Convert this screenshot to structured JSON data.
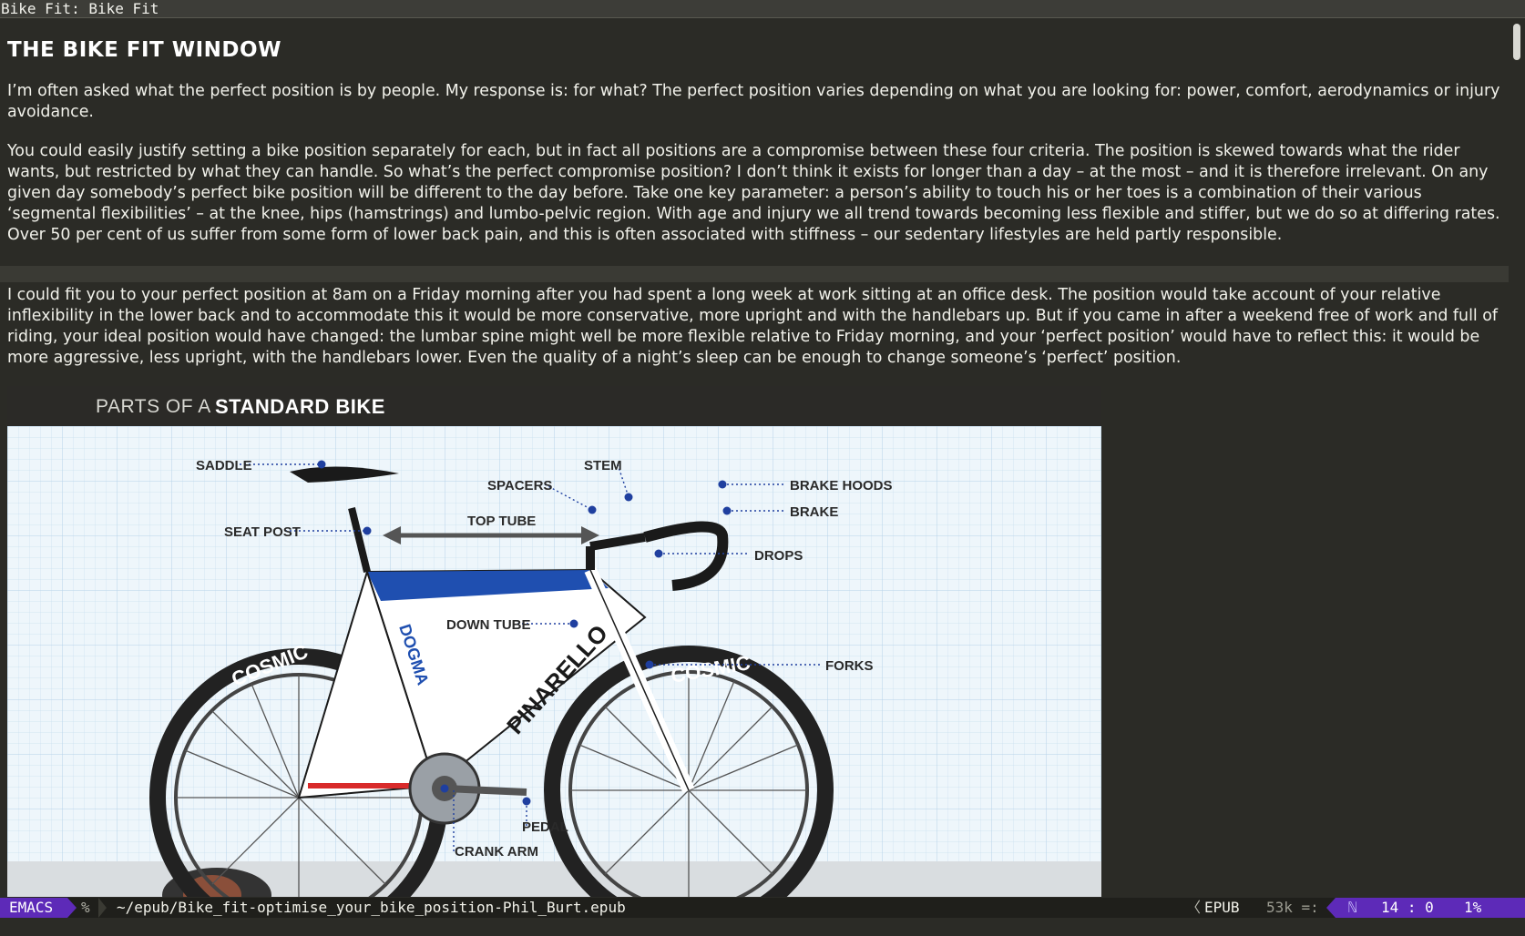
{
  "window": {
    "title": "Bike Fit: Bike Fit"
  },
  "article": {
    "heading": "THE BIKE FIT WINDOW",
    "paragraphs": [
      "I’m often asked what the perfect position is by people. My response is: for what? The perfect position varies depending on what you are looking for: power, comfort, aerodynamics or injury avoidance.",
      "You could easily justify setting a bike position separately for each, but in fact all positions are a compromise between these four criteria. The position is skewed towards what the rider wants, but restricted by what they can handle. So what’s the perfect compromise position? I don’t think it exists for longer than a day – at the most – and it is therefore irrelevant. On any given day somebody’s perfect bike position will be different to the day before. Take one key parameter: a person’s ability to touch his or her toes is a combination of their various ‘segmental flexibilities’ – at the knee, hips (hamstrings) and lumbo-pelvic region. With age and injury we all trend towards becoming less flexible and stiffer, but we do so at differing rates. Over 50 per cent of us suffer from some form of lower back pain, and this is often associated with stiffness – our sedentary lifestyles are held partly responsible.",
      "I could fit you to your perfect position at 8am on a Friday morning after you had spent a long week at work sitting at an office desk. The position would take account of your relative inflexibility in the lower back and to accommodate this it would be more conservative, more upright and with the handlebars up. But if you came in after a weekend free of work and full of riding, your ideal position would have changed: the lumbar spine might well be more flexible relative to Friday morning, and your ‘perfect position’ would have to reflect this: it would be more aggressive, less upright, with the handlebars lower. Even the quality of a night’s sleep can be enough to change someone’s ‘perfect’ position."
    ]
  },
  "figure": {
    "title_prefix": "PARTS OF A",
    "title_main": "STANDARD BIKE",
    "bike_brand": "PINARELLO",
    "bike_model": "DOGMA",
    "wheel_brand": "COSMIC",
    "labels": {
      "saddle": "SADDLE",
      "seat_post": "SEAT POST",
      "spacers": "SPACERS",
      "stem": "STEM",
      "top_tube": "TOP TUBE",
      "brake_hoods": "BRAKE HOODS",
      "brake": "BRAKE",
      "drops": "DROPS",
      "down_tube": "DOWN TUBE",
      "forks": "FORKS",
      "pedal": "PEDAL",
      "crank_arm": "CRANK ARM"
    }
  },
  "modeline": {
    "mode": "EMACS",
    "modified": "%",
    "file": "~/epub/Bike_fit-optimise_your_bike_position-Phil_Burt.epub",
    "major_mode": "EPUB",
    "size": "53k =:",
    "flag": "ℕ",
    "line_col": "14 :  0",
    "percent": "1%"
  },
  "colors": {
    "background": "#2b2b26",
    "text": "#f1f1ea",
    "accent": "#5d2ab8",
    "figure_bg": "#eef6fb",
    "bike_blue": "#1f4fb0",
    "bike_red": "#d82a2a"
  }
}
